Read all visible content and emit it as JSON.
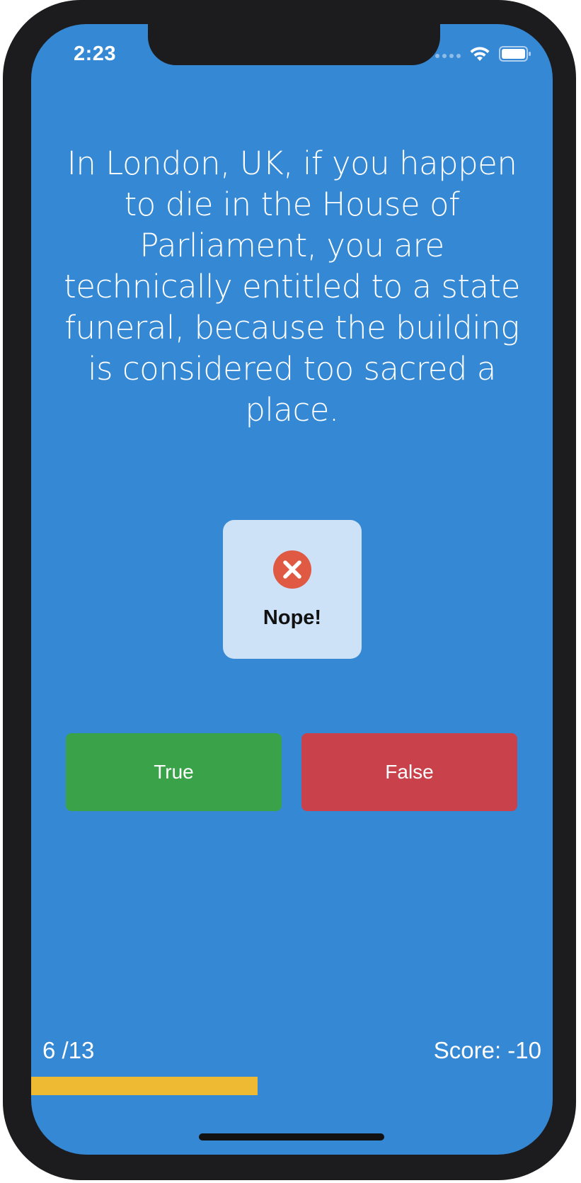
{
  "status_bar": {
    "time": "2:23",
    "icons": [
      "cellular-dots-icon",
      "wifi-icon",
      "battery-icon"
    ]
  },
  "question": {
    "text": "In London, UK, if you happen to die in the House of Parliament, you are technically entitled to a state funeral, because the building is considered too sacred a place."
  },
  "feedback_hud": {
    "icon": "error-x-circle-icon",
    "label": "Nope!"
  },
  "answers": {
    "true_label": "True",
    "false_label": "False"
  },
  "footer": {
    "progress_label": "6 /13",
    "score_label": "Score: -10",
    "progress_fraction": 0.434
  },
  "colors": {
    "background": "#3588d3",
    "true_button": "#3aa34a",
    "false_button": "#c9414a",
    "progress_bar": "#eeb933",
    "hud_background": "#cde1f7",
    "error_icon": "#e05a43"
  }
}
